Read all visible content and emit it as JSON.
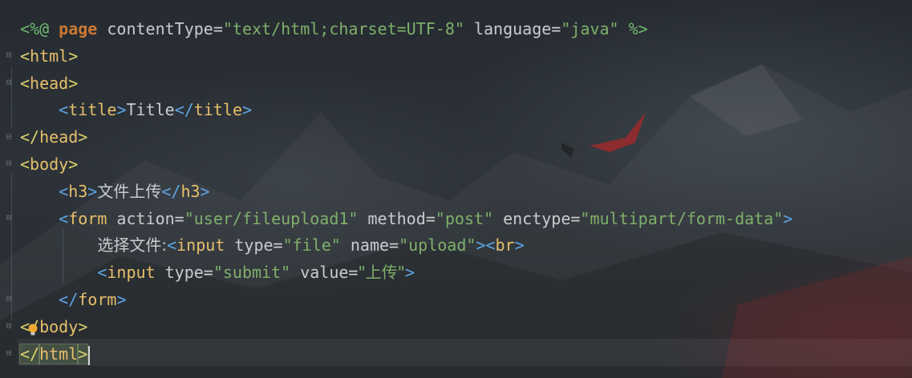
{
  "editor": {
    "top_cut": "--%>",
    "lines": [
      [
        {
          "t": "<%@ ",
          "c": "dir"
        },
        {
          "t": "page",
          "c": "kw"
        },
        {
          "t": " contentType=",
          "c": "attr"
        },
        {
          "t": "\"text/html;charset=UTF-8\"",
          "c": "str"
        },
        {
          "t": " language=",
          "c": "attr"
        },
        {
          "t": "\"java\"",
          "c": "str"
        },
        {
          "t": " %>",
          "c": "dir"
        }
      ],
      [
        {
          "t": "<",
          "c": "br"
        },
        {
          "t": "html",
          "c": "tag"
        },
        {
          "t": ">",
          "c": "br"
        }
      ],
      [
        {
          "t": "<",
          "c": "br"
        },
        {
          "t": "head",
          "c": "tag"
        },
        {
          "t": ">",
          "c": "br"
        }
      ],
      [
        {
          "t": "    "
        },
        {
          "t": "<",
          "c": "tagb"
        },
        {
          "t": "title",
          "c": "tag"
        },
        {
          "t": ">",
          "c": "tagb"
        },
        {
          "t": "Title",
          "c": "txt"
        },
        {
          "t": "</",
          "c": "tagb"
        },
        {
          "t": "title",
          "c": "tag"
        },
        {
          "t": ">",
          "c": "tagb"
        }
      ],
      [
        {
          "t": "</",
          "c": "br"
        },
        {
          "t": "head",
          "c": "tag"
        },
        {
          "t": ">",
          "c": "br"
        }
      ],
      [
        {
          "t": "<",
          "c": "br"
        },
        {
          "t": "body",
          "c": "tag"
        },
        {
          "t": ">",
          "c": "br"
        }
      ],
      [
        {
          "t": "    "
        },
        {
          "t": "<",
          "c": "tagb"
        },
        {
          "t": "h3",
          "c": "tag"
        },
        {
          "t": ">",
          "c": "tagb"
        },
        {
          "t": "文件上传",
          "c": "txt cjk"
        },
        {
          "t": "</",
          "c": "tagb"
        },
        {
          "t": "h3",
          "c": "tag"
        },
        {
          "t": ">",
          "c": "tagb"
        }
      ],
      [
        {
          "t": "    "
        },
        {
          "t": "<",
          "c": "tagb"
        },
        {
          "t": "form",
          "c": "tag"
        },
        {
          "t": " action=",
          "c": "attr"
        },
        {
          "t": "\"user/fileupload1\"",
          "c": "str"
        },
        {
          "t": " method=",
          "c": "attr"
        },
        {
          "t": "\"post\"",
          "c": "str"
        },
        {
          "t": " enctype=",
          "c": "attr"
        },
        {
          "t": "\"multipart/form-data\"",
          "c": "str"
        },
        {
          "t": ">",
          "c": "tagb"
        }
      ],
      [
        {
          "t": "        "
        },
        {
          "t": "选择文件:",
          "c": "txt cjk"
        },
        {
          "t": "<",
          "c": "tagb"
        },
        {
          "t": "input",
          "c": "tag"
        },
        {
          "t": " type=",
          "c": "attr"
        },
        {
          "t": "\"file\"",
          "c": "str"
        },
        {
          "t": " name=",
          "c": "attr"
        },
        {
          "t": "\"upload\"",
          "c": "str"
        },
        {
          "t": "><",
          "c": "tagb"
        },
        {
          "t": "br",
          "c": "tag"
        },
        {
          "t": ">",
          "c": "tagb"
        }
      ],
      [
        {
          "t": "        "
        },
        {
          "t": "<",
          "c": "tagb"
        },
        {
          "t": "input",
          "c": "tag"
        },
        {
          "t": " type=",
          "c": "attr"
        },
        {
          "t": "\"submit\"",
          "c": "str"
        },
        {
          "t": " value=",
          "c": "attr"
        },
        {
          "t": "\"上传\"",
          "c": "str cjk"
        },
        {
          "t": ">",
          "c": "tagb"
        }
      ],
      [
        {
          "t": "    "
        },
        {
          "t": "</",
          "c": "tagb"
        },
        {
          "t": "form",
          "c": "tag"
        },
        {
          "t": ">",
          "c": "tagb"
        }
      ],
      [
        {
          "t": "</",
          "c": "br"
        },
        {
          "t": "body",
          "c": "tag"
        },
        {
          "t": ">",
          "c": "br"
        }
      ],
      [
        {
          "t": "</",
          "c": "br match"
        },
        {
          "t": "html",
          "c": "tag match"
        },
        {
          "t": ">",
          "c": "br match"
        }
      ]
    ]
  },
  "icons": {
    "intention": "lightbulb-icon",
    "fold": "fold-marker-icon"
  },
  "colors": {
    "background": "#2a3036",
    "tag_name": "#e8bf6a",
    "string": "#7fb06a",
    "keyword": "#cc7832",
    "bracket": "#5fa5e6",
    "text": "#c9ccd0"
  }
}
